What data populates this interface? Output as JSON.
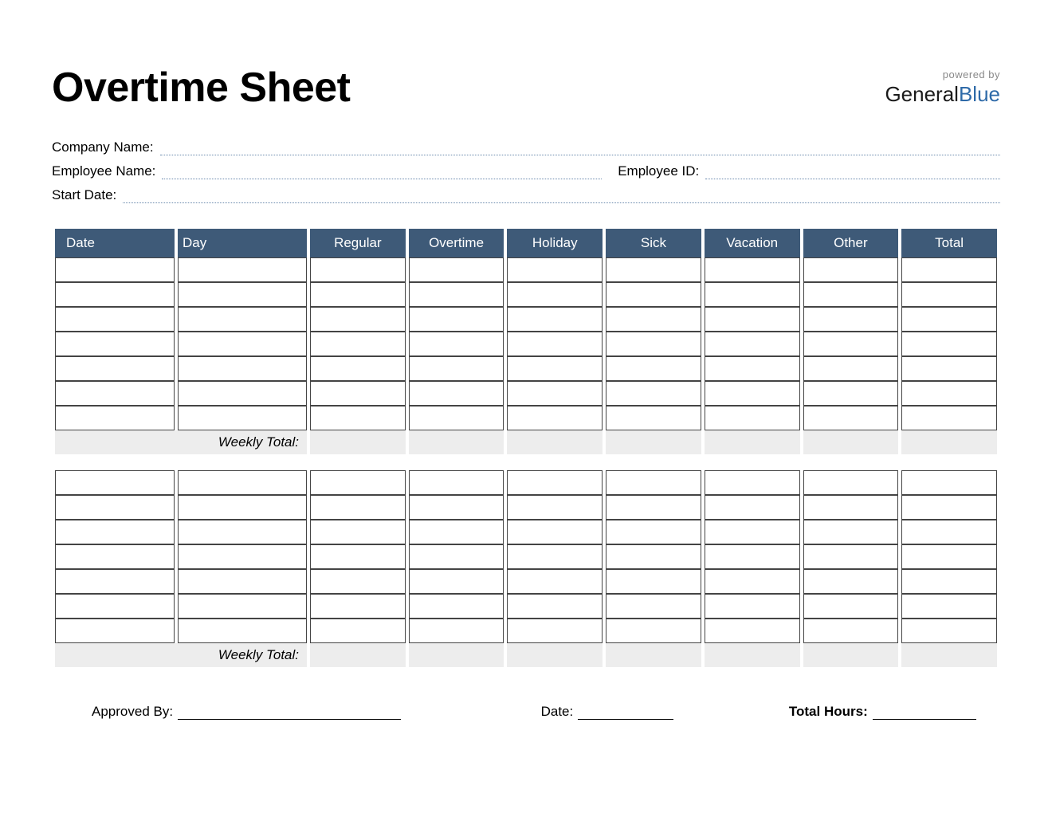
{
  "title": "Overtime Sheet",
  "brand": {
    "powered": "powered by",
    "name1": "General",
    "name2": "Blue"
  },
  "info": {
    "company_label": "Company Name:",
    "employee_label": "Employee Name:",
    "employee_id_label": "Employee ID:",
    "start_date_label": "Start Date:"
  },
  "columns": [
    "Date",
    "Day",
    "Regular",
    "Overtime",
    "Holiday",
    "Sick",
    "Vacation",
    "Other",
    "Total"
  ],
  "weekly_total_label": "Weekly Total:",
  "footer": {
    "approved_label": "Approved By:",
    "date_label": "Date:",
    "total_hours_label": "Total Hours:"
  }
}
